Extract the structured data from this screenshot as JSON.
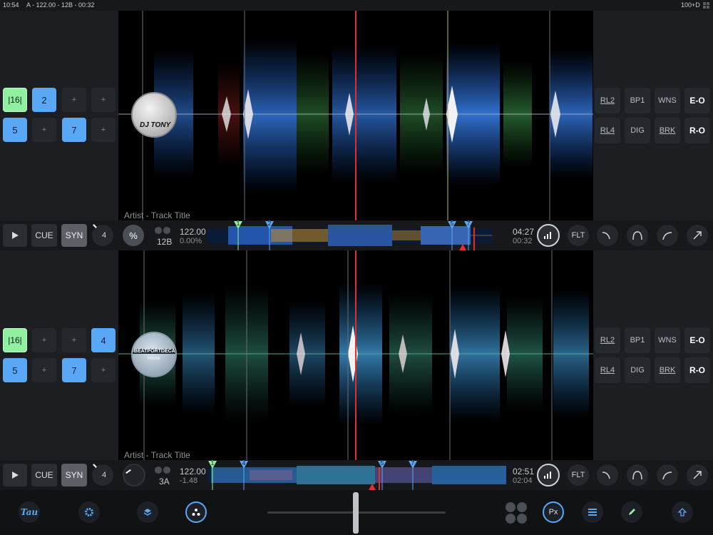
{
  "status": {
    "time": "10:54",
    "deck_info": "A - 122.00 - 12B - 00:32",
    "battery": "100+D"
  },
  "deck_a": {
    "pads": [
      "|16|",
      "2",
      "+",
      "+",
      "5",
      "+",
      "7",
      "+"
    ],
    "fx_row1": [
      "RL2",
      "BP1",
      "WNS",
      "E-O"
    ],
    "fx_row2": [
      "RL4",
      "DIG",
      "BRK",
      "R-O"
    ],
    "album_art_text": "DJ TONY",
    "track_title": "Artist - Track Title",
    "transport": {
      "play_icon": "play-icon",
      "cue": "CUE",
      "syn": "SYN",
      "loop": "4",
      "pitch": "%",
      "key": "12B",
      "bpm": "122.00",
      "pitch_value": "0.00%",
      "time_total": "04:27",
      "time_elapsed": "00:32",
      "flt": "FLT"
    },
    "cue_markers": [
      "1",
      "2",
      "5",
      "7"
    ]
  },
  "deck_b": {
    "pads": [
      "|16|",
      "+",
      "+",
      "4",
      "5",
      "+",
      "7",
      "+"
    ],
    "fx_row1": [
      "RL2",
      "BP1",
      "WNS",
      "E-O"
    ],
    "fx_row2": [
      "RL4",
      "DIG",
      "BRK",
      "R-O"
    ],
    "album_art_text": "#BEATPORTDECADE",
    "album_art_sub": "HOUSE",
    "track_title": "Artist - Track Title",
    "transport": {
      "play_icon": "play-icon",
      "cue": "CUE",
      "syn": "SYN",
      "loop": "4",
      "key": "3A",
      "bpm": "122.00",
      "pitch_value": "-1.48",
      "time_total": "02:51",
      "time_elapsed": "02:04",
      "flt": "FLT"
    },
    "cue_markers": [
      "1",
      "4",
      "5",
      "7"
    ]
  },
  "bottom": {
    "logo": "Tau",
    "px": "Px"
  },
  "colors": {
    "accent_blue": "#5aa8f5",
    "accent_green": "#8ff0a0",
    "playhead_red": "#e0302e"
  }
}
